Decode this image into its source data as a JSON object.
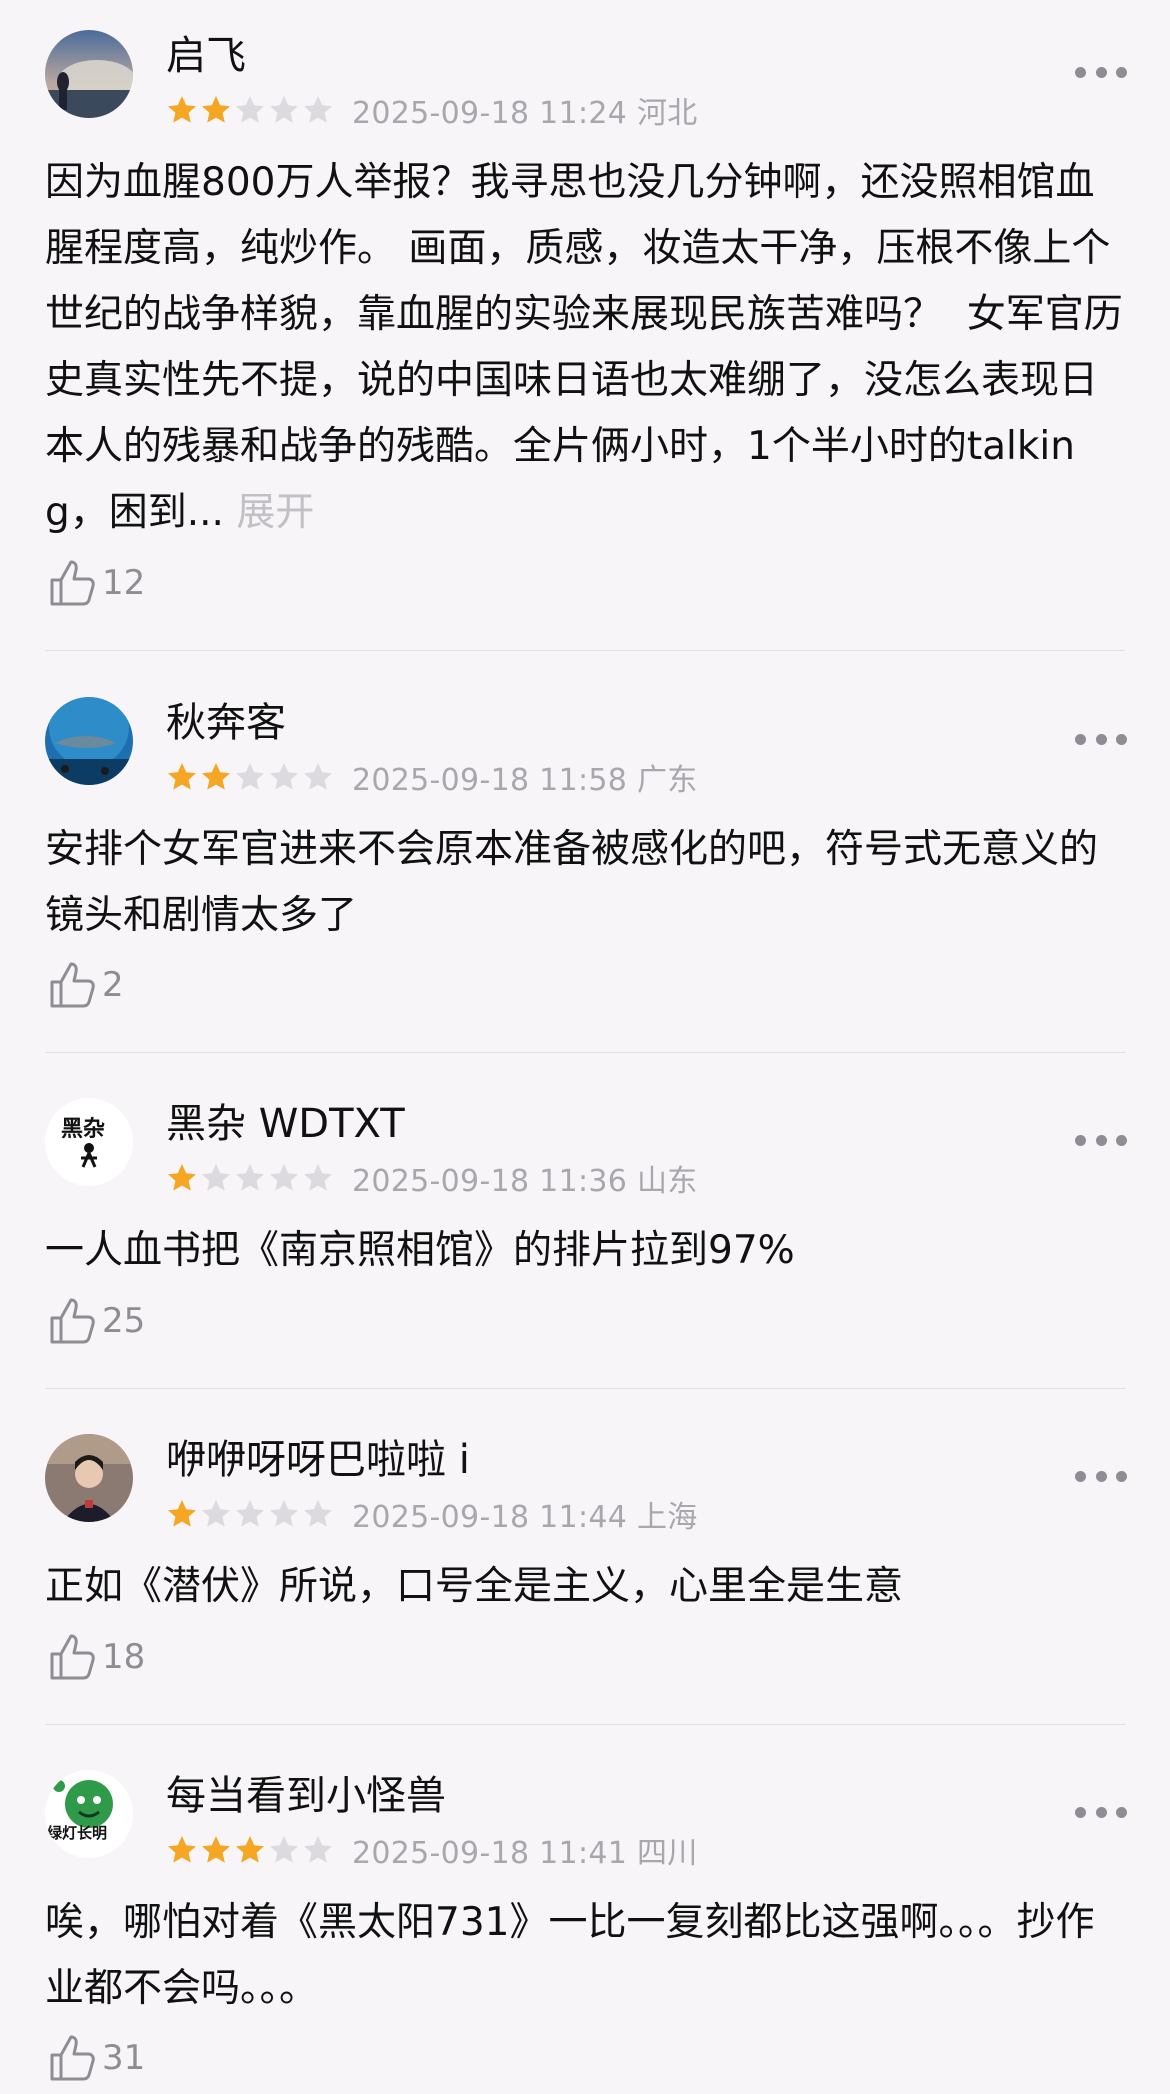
{
  "colors": {
    "background": "#f7f5f8",
    "star_filled": "#f5a623",
    "star_empty": "#dcdadf",
    "meta_text": "#a9a7ad",
    "expand_text": "#c2c0c5"
  },
  "reviews": [
    {
      "username": "启飞",
      "avatar_icon": "building-sunset-avatar",
      "rating": 2,
      "date_location": "2025-09-18 11:24 河北",
      "content": "因为血腥800万人举报？我寻思也没几分钟啊，还没照相馆血腥程度高，纯炒作。 画面，质感，妆造太干净，压根不像上个世纪的战争样貌，靠血腥的实验来展现民族苦难吗？  女军官历史真实性先不提，说的中国味日语也太难绷了，没怎么表现日本人的残暴和战争的残酷。全片俩小时，1个半小时的talking，困到...",
      "expand_label": "展开",
      "likes": "12"
    },
    {
      "username": "秋奔客",
      "avatar_icon": "aquarium-avatar",
      "rating": 2,
      "date_location": "2025-09-18 11:58 广东",
      "content": "安排个女军官进来不会原本准备被感化的吧，符号式无意义的镜头和剧情太多了",
      "expand_label": "",
      "likes": "2"
    },
    {
      "username": "黑杂 WDTXT",
      "avatar_icon": "black-white-logo-avatar",
      "avatar_text": "黑杂",
      "rating": 1,
      "date_location": "2025-09-18 11:36 山东",
      "content": "一人血书把《南京照相馆》的排片拉到97%",
      "expand_label": "",
      "likes": "25"
    },
    {
      "username": "咿咿呀呀巴啦啦 i",
      "avatar_icon": "person-photo-avatar",
      "rating": 1,
      "date_location": "2025-09-18 11:44 上海",
      "content": "正如《潜伏》所说，口号全是主义，心里全是生意",
      "expand_label": "",
      "likes": "18"
    },
    {
      "username": "每当看到小怪兽",
      "avatar_icon": "green-cartoon-avatar",
      "avatar_text": "绿灯长明",
      "rating": 3,
      "date_location": "2025-09-18 11:41 四川",
      "content": "唉，哪怕对着《黑太阳731》一比一复刻都比这强啊。。。抄作业都不会吗。。。",
      "expand_label": "",
      "likes": "31"
    }
  ]
}
